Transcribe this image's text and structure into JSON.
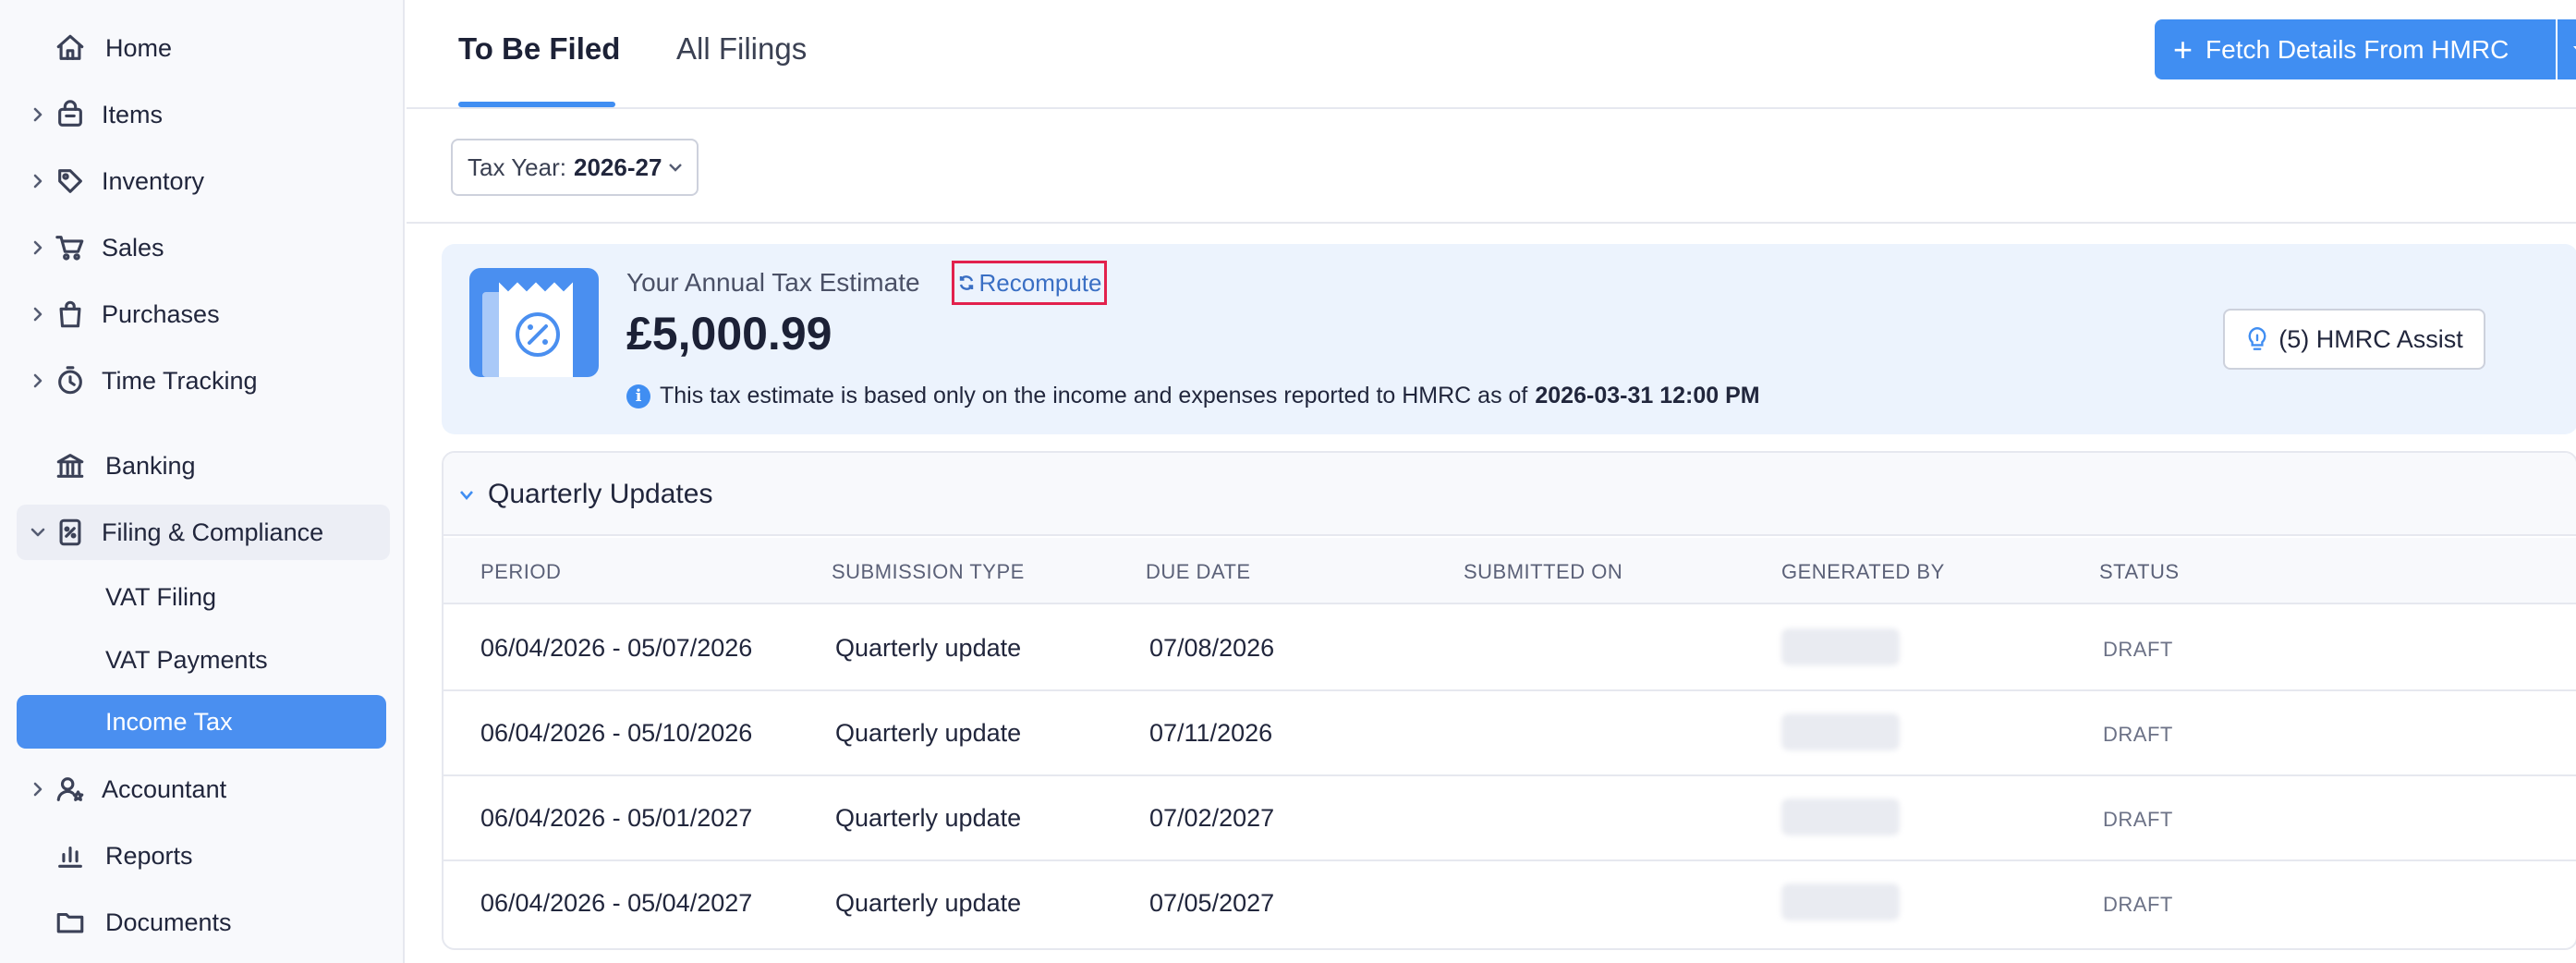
{
  "sidebar": {
    "items": [
      {
        "label": "Home",
        "icon": "home-icon"
      },
      {
        "label": "Items",
        "icon": "basket-icon"
      },
      {
        "label": "Inventory",
        "icon": "tag-icon"
      },
      {
        "label": "Sales",
        "icon": "cart-icon"
      },
      {
        "label": "Purchases",
        "icon": "bag-icon"
      },
      {
        "label": "Time Tracking",
        "icon": "timer-icon"
      },
      {
        "label": "Banking",
        "icon": "bank-icon"
      },
      {
        "label": "Filing & Compliance",
        "icon": "filing-icon"
      },
      {
        "label": "VAT Filing"
      },
      {
        "label": "VAT Payments"
      },
      {
        "label": "Income Tax"
      },
      {
        "label": "Accountant",
        "icon": "accountant-icon"
      },
      {
        "label": "Reports",
        "icon": "reports-icon"
      },
      {
        "label": "Documents",
        "icon": "folder-icon"
      }
    ]
  },
  "tabs": {
    "active": "To Be Filed",
    "inactive": "All Filings"
  },
  "toolbar": {
    "fetch_label": "Fetch Details From HMRC"
  },
  "filter": {
    "tax_year_label": "Tax Year:",
    "tax_year_value": "2026-27"
  },
  "estimate": {
    "title": "Your Annual Tax Estimate",
    "recompute_label": "Recompute",
    "amount": "£5,000.99",
    "note": "This tax estimate is based only on the income and expenses reported to HMRC as of",
    "note_date": "2026-03-31 12:00 PM",
    "assist_label": "(5) HMRC Assist"
  },
  "quarterly": {
    "title": "Quarterly Updates",
    "columns": [
      "PERIOD",
      "SUBMISSION TYPE",
      "DUE DATE",
      "SUBMITTED ON",
      "GENERATED BY",
      "STATUS"
    ],
    "rows": [
      {
        "period": "06/04/2026 - 05/07/2026",
        "type": "Quarterly update",
        "due": "07/08/2026",
        "status": "DRAFT"
      },
      {
        "period": "06/04/2026 - 05/10/2026",
        "type": "Quarterly update",
        "due": "07/11/2026",
        "status": "DRAFT"
      },
      {
        "period": "06/04/2026 - 05/01/2027",
        "type": "Quarterly update",
        "due": "07/02/2027",
        "status": "DRAFT"
      },
      {
        "period": "06/04/2026 - 05/04/2027",
        "type": "Quarterly update",
        "due": "07/05/2027",
        "status": "DRAFT"
      }
    ]
  },
  "colors": {
    "accent": "#408ef2",
    "highlight_border": "#e2214d",
    "estimate_bg": "#ecf3fd"
  }
}
